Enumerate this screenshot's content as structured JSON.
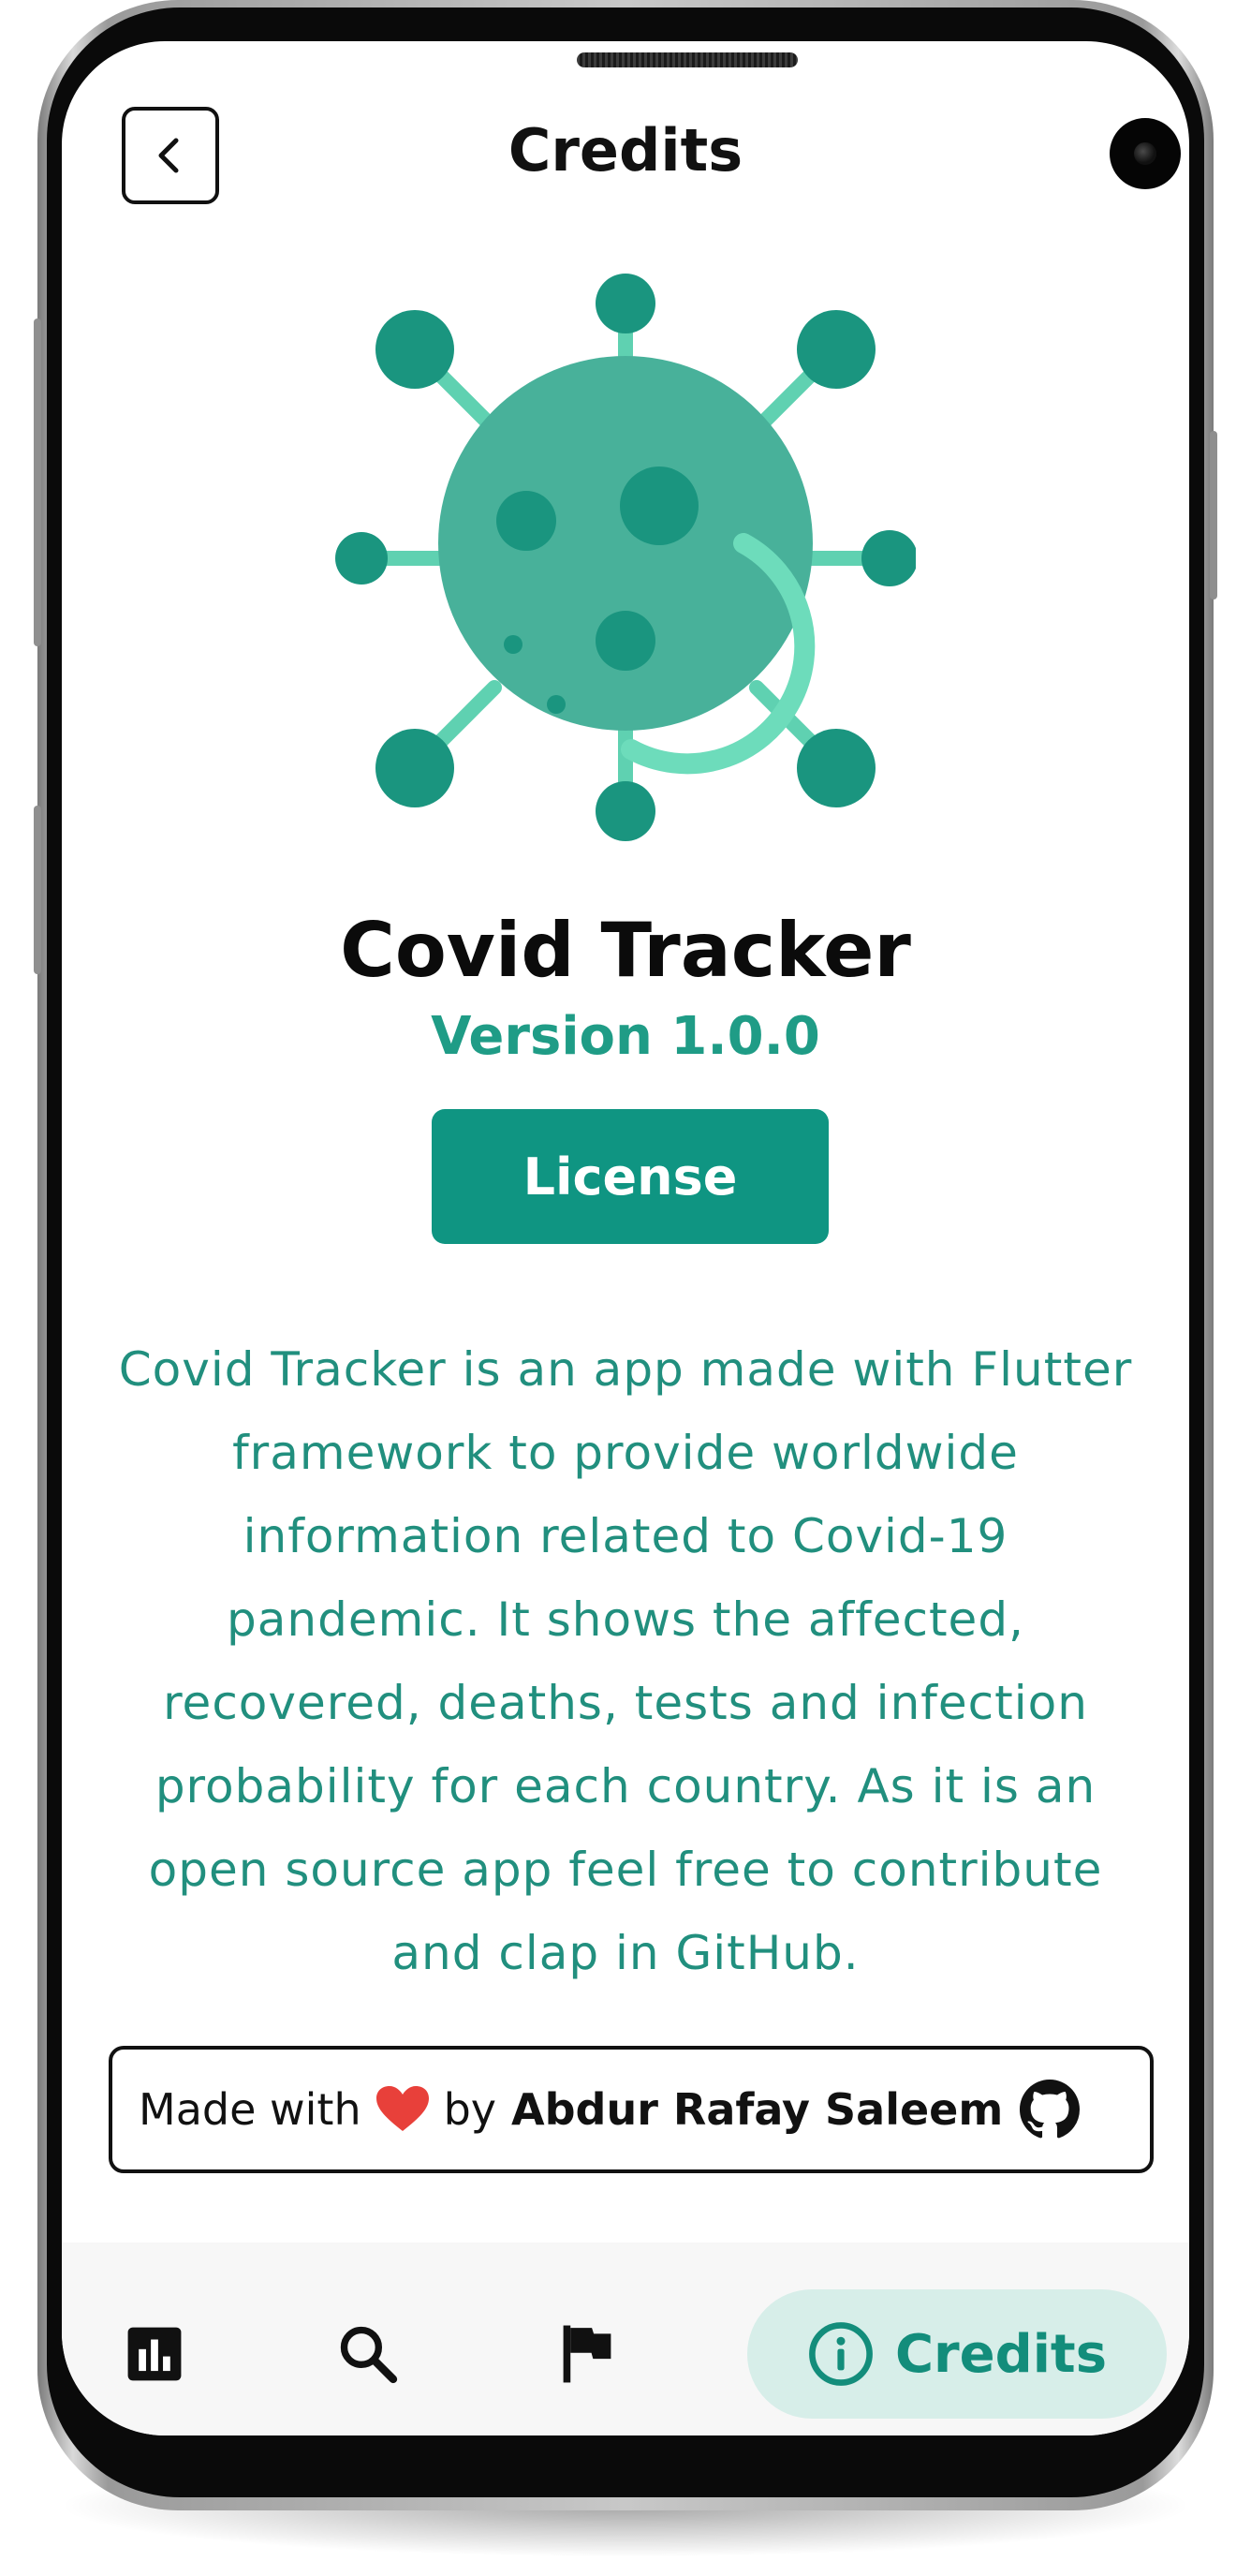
{
  "header": {
    "title": "Credits",
    "back_icon": "chevron-left-icon"
  },
  "app": {
    "logo_icon": "virus-icon",
    "name": "Covid Tracker",
    "version": "Version 1.0.0",
    "license_label": "License",
    "description": "Covid Tracker is an app made with Flutter framework to provide worldwide information related to Covid-19 pandemic. It shows the affected, recovered, deaths, tests and infection probability for each country. As it is an open source app feel free to contribute and clap in GitHub."
  },
  "credit": {
    "prefix": "Made with",
    "heart_icon": "heart-icon",
    "by": "by",
    "author": "Abdur Rafay Saleem",
    "github_icon": "github-icon"
  },
  "bottom_nav": {
    "items": [
      {
        "icon": "bar-chart-icon"
      },
      {
        "icon": "search-icon"
      },
      {
        "icon": "flag-icon"
      },
      {
        "icon": "info-icon",
        "label": "Credits",
        "active": true
      }
    ]
  },
  "colors": {
    "accent": "#0f9582",
    "accent_text": "#1f9c86",
    "active_tab_bg": "#d7eee9",
    "heart": "#e8403a"
  }
}
